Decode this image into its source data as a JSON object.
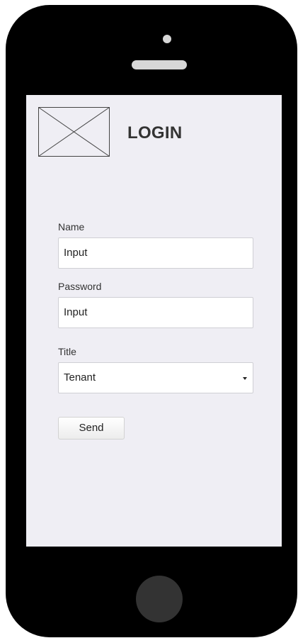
{
  "header": {
    "title": "LOGIN"
  },
  "form": {
    "name": {
      "label": "Name",
      "value": "Input"
    },
    "password": {
      "label": "Password",
      "value": "Input"
    },
    "title": {
      "label": "Title",
      "selected": "Tenant"
    },
    "send_label": "Send"
  },
  "icons": {
    "logo": "image-placeholder-icon",
    "select_caret": "chevron-down-icon"
  },
  "colors": {
    "device": "#000000",
    "screen_bg": "#efeef4",
    "text": "#333333",
    "input_border": "#cfcfd4"
  }
}
